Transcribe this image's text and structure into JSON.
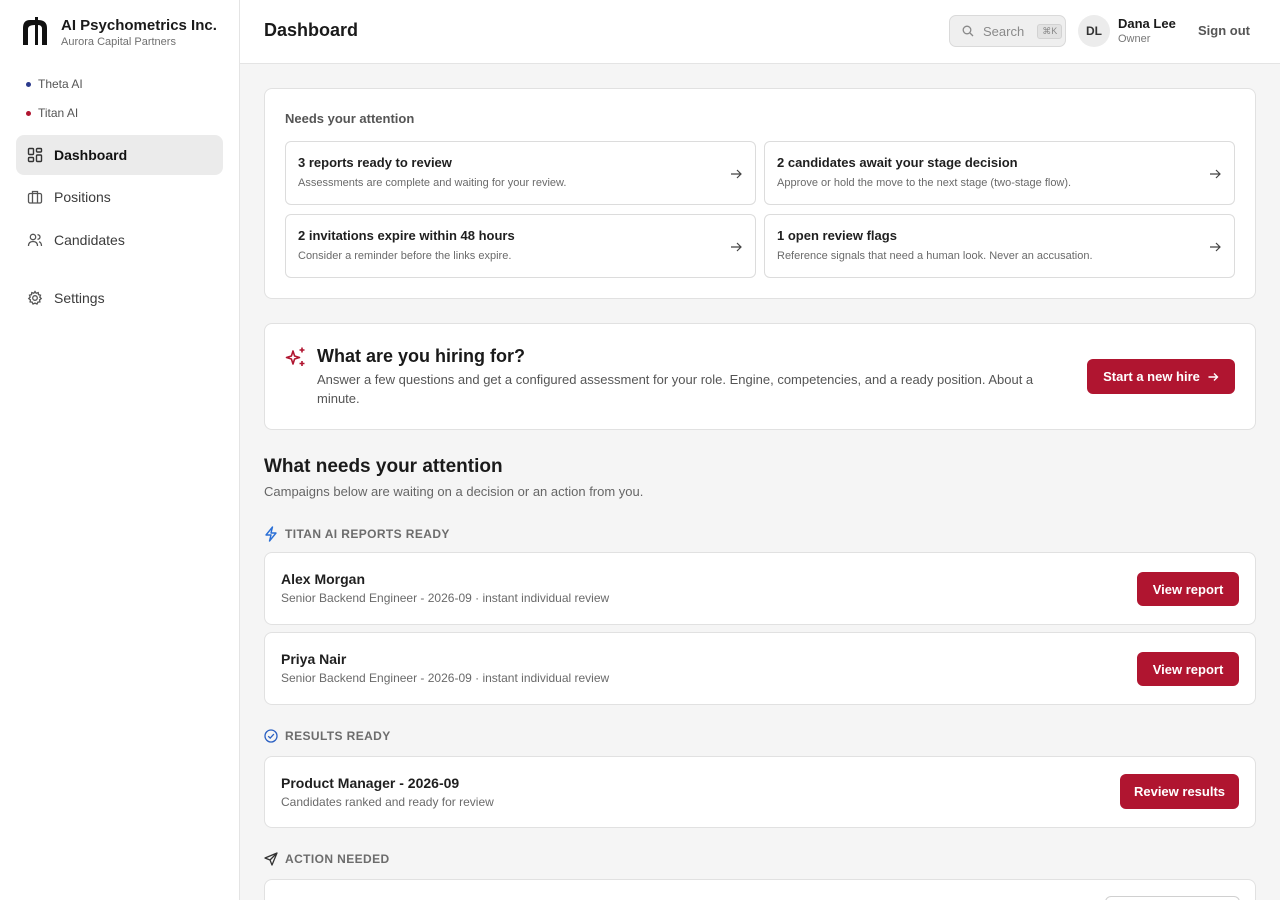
{
  "brand": {
    "name": "AI Psychometrics Inc.",
    "subtitle": "Aurora Capital Partners"
  },
  "orgs": [
    {
      "label": "Theta AI",
      "color": "#2b3a8c"
    },
    {
      "label": "Titan AI",
      "color": "#b01530"
    }
  ],
  "nav": {
    "dashboard": "Dashboard",
    "positions": "Positions",
    "candidates": "Candidates",
    "settings": "Settings"
  },
  "header": {
    "title": "Dashboard",
    "search_label": "Search",
    "search_shortcut": "⌘K",
    "user_initials": "DL",
    "user_name": "Dana Lee",
    "user_role": "Owner",
    "signout_label": "Sign out"
  },
  "attention_panel": {
    "label": "Needs your attention",
    "tiles": [
      {
        "title": "3 reports ready to review",
        "desc": "Assessments are complete and waiting for your review."
      },
      {
        "title": "2 candidates await your stage decision",
        "desc": "Approve or hold the move to the next stage (two-stage flow)."
      },
      {
        "title": "2 invitations expire within 48 hours",
        "desc": "Consider a reminder before the links expire."
      },
      {
        "title": "1 open review flags",
        "desc": "Reference signals that need a human look. Never an accusation."
      }
    ]
  },
  "hire": {
    "title": "What are you hiring for?",
    "desc": "Answer a few questions and get a configured assessment for your role. Engine, competencies, and a ready position. About a minute.",
    "button": "Start a new hire"
  },
  "attention_section": {
    "title": "What needs your attention",
    "subtitle": "Campaigns below are waiting on a decision or an action from you."
  },
  "groups": {
    "titan_reports": {
      "label": "TITAN AI REPORTS READY",
      "rows": [
        {
          "name": "Alex Morgan",
          "sub": "Senior Backend Engineer - 2026-09 · instant individual review",
          "action": "View report"
        },
        {
          "name": "Priya Nair",
          "sub": "Senior Backend Engineer - 2026-09 · instant individual review",
          "action": "View report"
        }
      ]
    },
    "results_ready": {
      "label": "RESULTS READY",
      "rows": [
        {
          "name": "Product Manager - 2026-09",
          "sub": "Candidates ranked and ready for review",
          "action": "Review results"
        }
      ]
    },
    "action_needed": {
      "label": "ACTION NEEDED"
    }
  },
  "colors": {
    "accent": "#b01530",
    "titan_icon": "#2a6fd6",
    "results_icon": "#2a5fc2"
  }
}
